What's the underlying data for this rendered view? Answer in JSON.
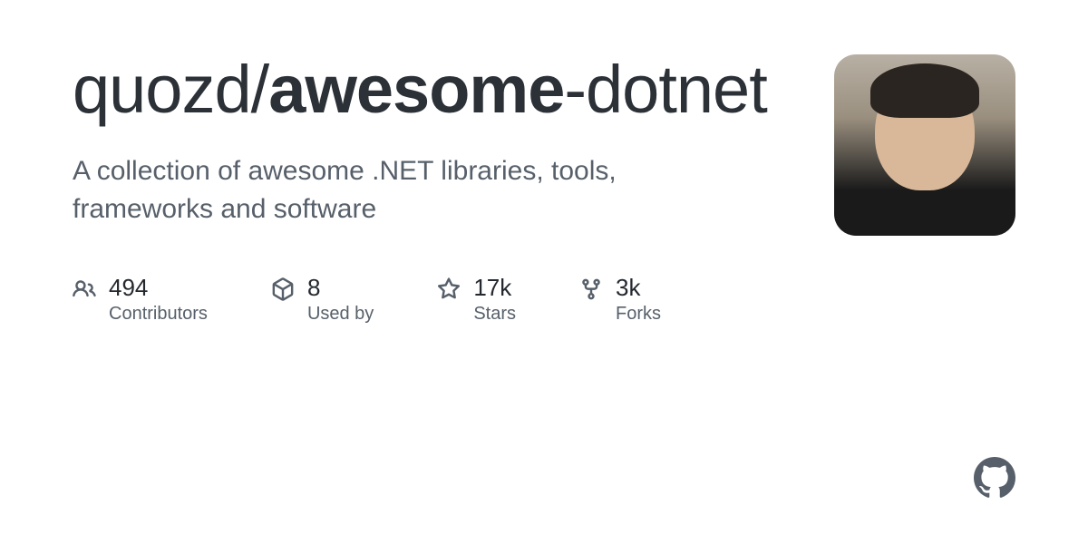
{
  "repo": {
    "owner": "quozd",
    "slash": "/",
    "name_bold": "awesome",
    "name_rest": "-dotnet"
  },
  "description": "A collection of awesome .NET libraries, tools, frameworks and software",
  "stats": {
    "contributors": {
      "count": "494",
      "label": "Contributors"
    },
    "usedby": {
      "count": "8",
      "label": "Used by"
    },
    "stars": {
      "count": "17k",
      "label": "Stars"
    },
    "forks": {
      "count": "3k",
      "label": "Forks"
    }
  }
}
